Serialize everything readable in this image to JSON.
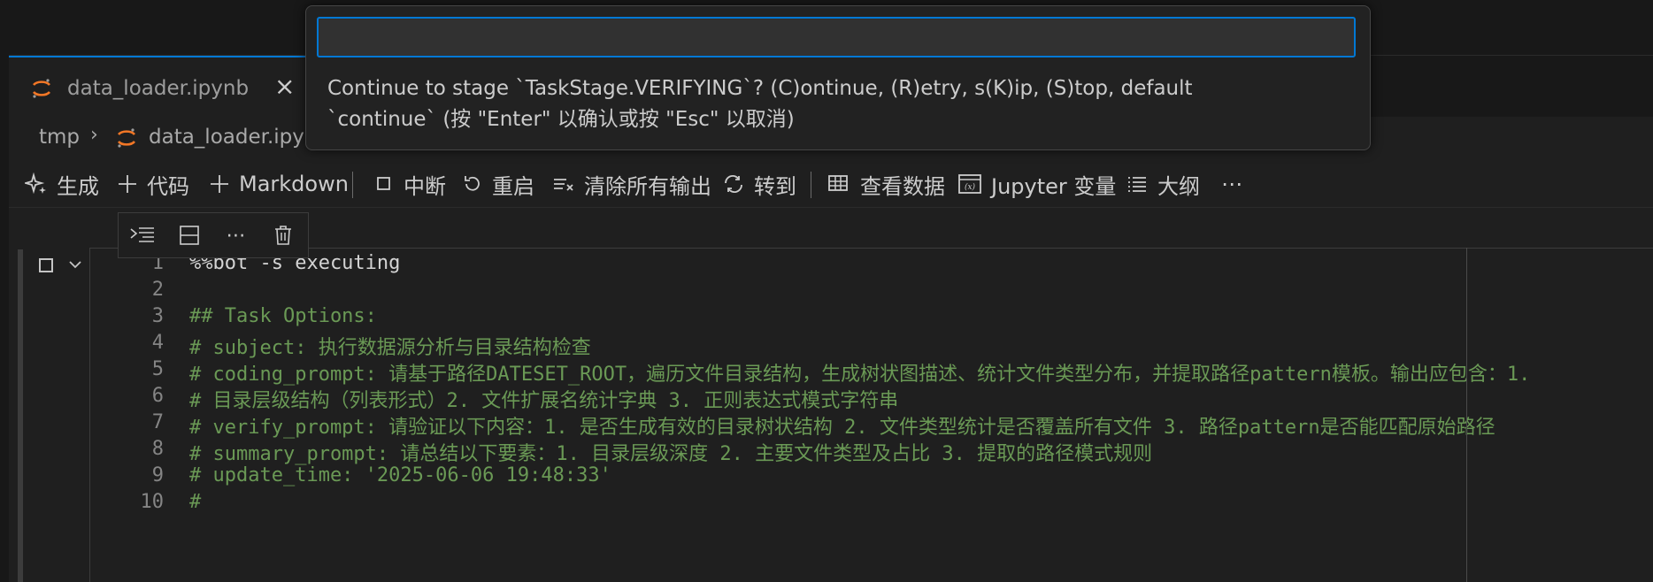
{
  "tab": {
    "label": "data_loader.ipynb",
    "close": "×",
    "icon": "jupyter-icon"
  },
  "breadcrumb": {
    "root": "tmp",
    "separator": "›",
    "file": "data_loader.ipynb"
  },
  "toolbar": {
    "generate": "生成",
    "code": "代码",
    "markdown": "Markdown",
    "interrupt": "中断",
    "restart": "重启",
    "clear_outputs": "清除所有输出",
    "goto": "转到",
    "view_data": "查看数据",
    "jupyter_vars": "Jupyter 变量",
    "outline": "大纲",
    "more": "⋯"
  },
  "cell_toolbar": {
    "more": "⋯"
  },
  "quick_input": {
    "value": "",
    "message_line1": "Continue to stage `TaskStage.VERIFYING`? (C)ontinue, (R)etry, s(K)ip, (S)top, default",
    "message_line2": "`continue` (按 \"Enter\" 以确认或按 \"Esc\" 以取消)"
  },
  "code_lines": [
    {
      "n": "1",
      "text": "%%bot -s executing",
      "kind": "default"
    },
    {
      "n": "2",
      "text": "",
      "kind": "default"
    },
    {
      "n": "3",
      "text": "## Task Options:",
      "kind": "comment"
    },
    {
      "n": "4",
      "text": "# subject: 执行数据源分析与目录结构检查",
      "kind": "comment"
    },
    {
      "n": "5",
      "text": "# coding_prompt: 请基于路径DATESET_ROOT，遍历文件目录结构，生成树状图描述、统计文件类型分布，并提取路径pattern模板。输出应包含：1.",
      "kind": "comment"
    },
    {
      "n": "6",
      "text": "#     目录层级结构（列表形式）2. 文件扩展名统计字典 3. 正则表达式模式字符串",
      "kind": "comment"
    },
    {
      "n": "7",
      "text": "# verify_prompt: 请验证以下内容：1. 是否生成有效的目录树状结构 2. 文件类型统计是否覆盖所有文件 3. 路径pattern是否能匹配原始路径",
      "kind": "comment"
    },
    {
      "n": "8",
      "text": "# summary_prompt: 请总结以下要素：1. 目录层级深度 2. 主要文件类型及占比 3. 提取的路径模式规则",
      "kind": "comment"
    },
    {
      "n": "9",
      "text": "# update_time: '2025-06-06 19:48:33'",
      "kind": "comment"
    },
    {
      "n": "10",
      "text": "#",
      "kind": "comment"
    }
  ]
}
